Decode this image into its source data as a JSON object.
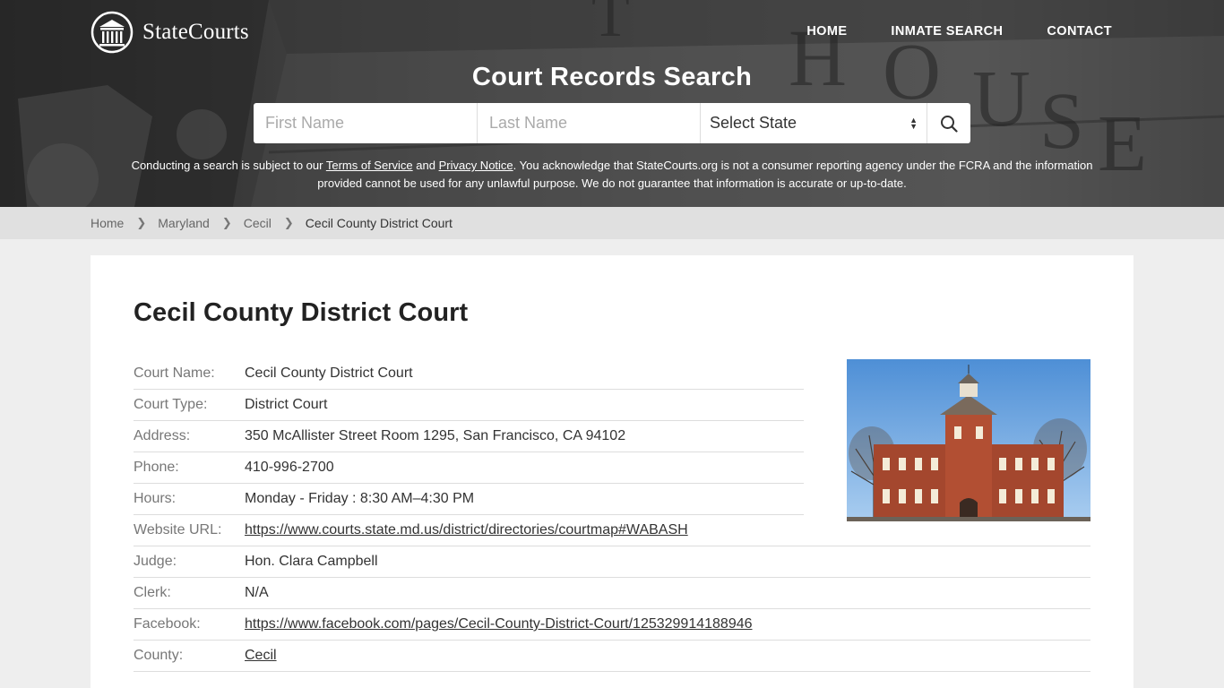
{
  "brand": {
    "name": "StateCourts"
  },
  "nav": {
    "home": "HOME",
    "inmate_search": "INMATE SEARCH",
    "contact": "CONTACT"
  },
  "hero": {
    "title": "Court Records Search",
    "first_name_placeholder": "First Name",
    "last_name_placeholder": "Last Name",
    "state_select": "Select State"
  },
  "disclaimer": {
    "before": "Conducting a search is subject to our ",
    "terms": "Terms of Service",
    "and": " and ",
    "privacy": "Privacy Notice",
    "after": ". You acknowledge that StateCourts.org is not a consumer reporting agency under the FCRA and the information provided cannot be used for any unlawful purpose. We do not guarantee that information is accurate or up-to-date."
  },
  "breadcrumb": {
    "home": "Home",
    "state": "Maryland",
    "county": "Cecil",
    "current": "Cecil County District Court"
  },
  "court": {
    "title": "Cecil County District Court",
    "rows": [
      {
        "label": "Court Name:",
        "value": "Cecil County District Court"
      },
      {
        "label": "Court Type:",
        "value": "District Court"
      },
      {
        "label": "Address:",
        "value": "350 McAllister Street Room 1295, San Francisco, CA 94102"
      },
      {
        "label": "Phone:",
        "value": "410-996-2700"
      },
      {
        "label": "Hours:",
        "value": "Monday - Friday : 8:30 AM–4:30 PM"
      },
      {
        "label": "Website URL:",
        "value": "https://www.courts.state.md.us/district/directories/courtmap#WABASH"
      },
      {
        "label": "Judge:",
        "value": "Hon. Clara Campbell"
      },
      {
        "label": "Clerk:",
        "value": "N/A"
      },
      {
        "label": "Facebook:",
        "value": "https://www.facebook.com/pages/Cecil-County-District-Court/125329914188946"
      },
      {
        "label": "County:",
        "value": "Cecil"
      }
    ]
  }
}
